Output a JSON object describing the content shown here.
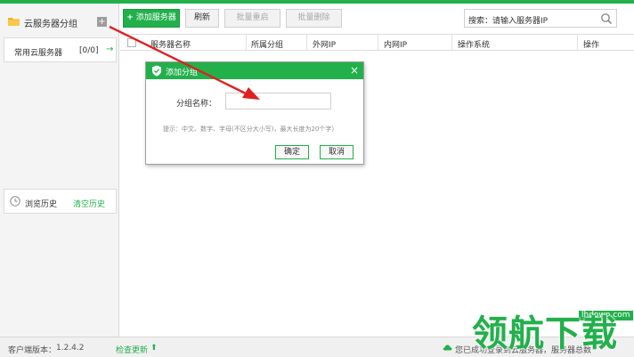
{
  "sidebar": {
    "title": "云服务器分组",
    "add_icon_text": "+",
    "group": {
      "label": "常用云服务器",
      "count": "[0/0]",
      "arrow": "→"
    },
    "history": {
      "label": "浏览历史",
      "clear": "清空历史"
    }
  },
  "toolbar": {
    "add_server": "添加服务器",
    "add_plus": "+",
    "refresh": "刷新",
    "batch_restart": "批量重启",
    "batch_delete": "批量删除",
    "search_label": "搜索：请输入服务器IP"
  },
  "table": {
    "columns": [
      "服务器名称",
      "所属分组",
      "外网IP",
      "内网IP",
      "操作系统",
      "操作"
    ]
  },
  "dialog": {
    "title": "添加分组",
    "close": "×",
    "field_label": "分组名称：",
    "field_value": "",
    "hint": "提示：中文、数字、字母(不区分大小写)，最大长度为20个字）",
    "ok": "确定",
    "cancel": "取消"
  },
  "statusbar": {
    "version_label": "客户端版本：",
    "version": "1.2.4.2",
    "update": "检查更新",
    "update_icon": "⬆",
    "status": "您已成功登录到云服务器，服务器总数"
  },
  "watermark": {
    "url": "lhdown.com",
    "logo": "领航下载"
  },
  "colors": {
    "accent": "#22b04b",
    "arrow": "#e02020"
  },
  "icons": [
    "folder-icon",
    "add-icon",
    "arrow-right-icon",
    "clock-icon",
    "plus-icon",
    "search-icon",
    "shield-icon",
    "close-icon",
    "upload-icon",
    "cloud-icon"
  ]
}
